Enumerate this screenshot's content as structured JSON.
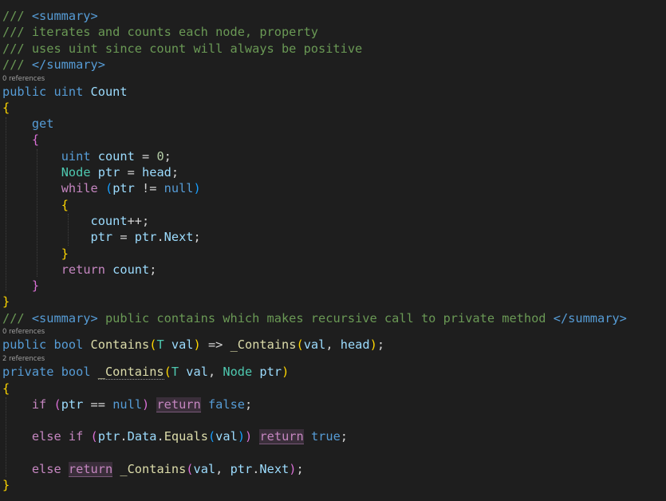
{
  "editor": {
    "code_lens": {
      "count": "0 references",
      "contains": "0 references",
      "private_contains": "2 references"
    },
    "lines": [
      {
        "id": "l1",
        "tokens": [
          {
            "t": "/// ",
            "c": "t-comment"
          },
          {
            "t": "<summary>",
            "c": "t-doctag"
          }
        ]
      },
      {
        "id": "l2",
        "tokens": [
          {
            "t": "/// iterates and counts each node, property",
            "c": "t-comment"
          }
        ]
      },
      {
        "id": "l3",
        "tokens": [
          {
            "t": "/// uses uint since count will always be positive",
            "c": "t-comment"
          }
        ]
      },
      {
        "id": "l4",
        "tokens": [
          {
            "t": "/// ",
            "c": "t-comment"
          },
          {
            "t": "</summary>",
            "c": "t-doctag"
          }
        ]
      },
      {
        "id": "l5",
        "tokens": [
          {
            "t": "public",
            "c": "t-kw"
          },
          {
            "t": " ",
            "c": "t-punc"
          },
          {
            "t": "uint",
            "c": "t-kw"
          },
          {
            "t": " ",
            "c": "t-punc"
          },
          {
            "t": "Count",
            "c": "t-var"
          }
        ]
      },
      {
        "id": "l6",
        "tokens": [
          {
            "t": "{",
            "c": "t-b1"
          }
        ]
      },
      {
        "id": "l7",
        "tokens": [
          {
            "t": "    ",
            "c": "t-punc"
          },
          {
            "t": "get",
            "c": "t-kw"
          }
        ]
      },
      {
        "id": "l8",
        "tokens": [
          {
            "t": "    ",
            "c": "t-punc"
          },
          {
            "t": "{",
            "c": "t-b2"
          }
        ]
      },
      {
        "id": "l9",
        "tokens": [
          {
            "t": "        ",
            "c": "t-punc"
          },
          {
            "t": "uint",
            "c": "t-kw"
          },
          {
            "t": " ",
            "c": "t-punc"
          },
          {
            "t": "count",
            "c": "t-var"
          },
          {
            "t": " = ",
            "c": "t-punc"
          },
          {
            "t": "0",
            "c": "t-num"
          },
          {
            "t": ";",
            "c": "t-punc"
          }
        ]
      },
      {
        "id": "l10",
        "tokens": [
          {
            "t": "        ",
            "c": "t-punc"
          },
          {
            "t": "Node",
            "c": "t-type"
          },
          {
            "t": " ",
            "c": "t-punc"
          },
          {
            "t": "ptr",
            "c": "t-var"
          },
          {
            "t": " = ",
            "c": "t-punc"
          },
          {
            "t": "head",
            "c": "t-var"
          },
          {
            "t": ";",
            "c": "t-punc"
          }
        ]
      },
      {
        "id": "l11",
        "tokens": [
          {
            "t": "        ",
            "c": "t-punc"
          },
          {
            "t": "while",
            "c": "t-ctrl"
          },
          {
            "t": " ",
            "c": "t-punc"
          },
          {
            "t": "(",
            "c": "t-b3"
          },
          {
            "t": "ptr",
            "c": "t-var"
          },
          {
            "t": " != ",
            "c": "t-punc"
          },
          {
            "t": "null",
            "c": "t-kw"
          },
          {
            "t": ")",
            "c": "t-b3"
          }
        ]
      },
      {
        "id": "l12",
        "tokens": [
          {
            "t": "        ",
            "c": "t-punc"
          },
          {
            "t": "{",
            "c": "t-b1"
          }
        ]
      },
      {
        "id": "l13",
        "tokens": [
          {
            "t": "            ",
            "c": "t-punc"
          },
          {
            "t": "count",
            "c": "t-var"
          },
          {
            "t": "++;",
            "c": "t-punc"
          }
        ]
      },
      {
        "id": "l14",
        "tokens": [
          {
            "t": "            ",
            "c": "t-punc"
          },
          {
            "t": "ptr",
            "c": "t-var"
          },
          {
            "t": " = ",
            "c": "t-punc"
          },
          {
            "t": "ptr",
            "c": "t-var"
          },
          {
            "t": ".",
            "c": "t-punc"
          },
          {
            "t": "Next",
            "c": "t-var"
          },
          {
            "t": ";",
            "c": "t-punc"
          }
        ]
      },
      {
        "id": "l15",
        "tokens": [
          {
            "t": "        ",
            "c": "t-punc"
          },
          {
            "t": "}",
            "c": "t-b1"
          }
        ]
      },
      {
        "id": "l16",
        "tokens": [
          {
            "t": "        ",
            "c": "t-punc"
          },
          {
            "t": "return",
            "c": "t-ctrl"
          },
          {
            "t": " ",
            "c": "t-punc"
          },
          {
            "t": "count",
            "c": "t-var"
          },
          {
            "t": ";",
            "c": "t-punc"
          }
        ]
      },
      {
        "id": "l17",
        "tokens": [
          {
            "t": "    ",
            "c": "t-punc"
          },
          {
            "t": "}",
            "c": "t-b2"
          }
        ]
      },
      {
        "id": "l18",
        "tokens": [
          {
            "t": "}",
            "c": "t-b1"
          }
        ]
      },
      {
        "id": "l19",
        "tokens": [
          {
            "t": "/// ",
            "c": "t-comment"
          },
          {
            "t": "<summary>",
            "c": "t-doctag"
          },
          {
            "t": " public contains which makes recursive call to private method ",
            "c": "t-comment"
          },
          {
            "t": "</summary>",
            "c": "t-doctag"
          }
        ]
      },
      {
        "id": "l20",
        "tokens": [
          {
            "t": "public",
            "c": "t-kw"
          },
          {
            "t": " ",
            "c": "t-punc"
          },
          {
            "t": "bool",
            "c": "t-kw"
          },
          {
            "t": " ",
            "c": "t-punc"
          },
          {
            "t": "Contains",
            "c": "t-fn"
          },
          {
            "t": "(",
            "c": "t-b1"
          },
          {
            "t": "T",
            "c": "t-type"
          },
          {
            "t": " ",
            "c": "t-punc"
          },
          {
            "t": "val",
            "c": "t-var"
          },
          {
            "t": ")",
            "c": "t-b1"
          },
          {
            "t": " => ",
            "c": "t-punc"
          },
          {
            "t": "_Contains",
            "c": "t-fn"
          },
          {
            "t": "(",
            "c": "t-b1"
          },
          {
            "t": "val",
            "c": "t-var"
          },
          {
            "t": ", ",
            "c": "t-punc"
          },
          {
            "t": "head",
            "c": "t-var"
          },
          {
            "t": ")",
            "c": "t-b1"
          },
          {
            "t": ";",
            "c": "t-punc"
          }
        ]
      },
      {
        "id": "l21",
        "tokens": [
          {
            "t": "private",
            "c": "t-kw"
          },
          {
            "t": " ",
            "c": "t-punc"
          },
          {
            "t": "bool",
            "c": "t-kw"
          },
          {
            "t": " ",
            "c": "t-punc"
          },
          {
            "t": "_Contains",
            "c": "t-fn squiggle"
          },
          {
            "t": "(",
            "c": "t-b1"
          },
          {
            "t": "T",
            "c": "t-type"
          },
          {
            "t": " ",
            "c": "t-punc"
          },
          {
            "t": "val",
            "c": "t-var"
          },
          {
            "t": ", ",
            "c": "t-punc"
          },
          {
            "t": "Node",
            "c": "t-type"
          },
          {
            "t": " ",
            "c": "t-punc"
          },
          {
            "t": "ptr",
            "c": "t-var"
          },
          {
            "t": ")",
            "c": "t-b1"
          }
        ]
      },
      {
        "id": "l22",
        "tokens": [
          {
            "t": "{",
            "c": "t-b1"
          }
        ]
      },
      {
        "id": "l23",
        "tokens": [
          {
            "t": "    ",
            "c": "t-punc"
          },
          {
            "t": "if",
            "c": "t-ctrl"
          },
          {
            "t": " ",
            "c": "t-punc"
          },
          {
            "t": "(",
            "c": "t-b2"
          },
          {
            "t": "ptr",
            "c": "t-var"
          },
          {
            "t": " == ",
            "c": "t-punc"
          },
          {
            "t": "null",
            "c": "t-kw"
          },
          {
            "t": ")",
            "c": "t-b2"
          },
          {
            "t": " ",
            "c": "t-punc"
          },
          {
            "t": "return",
            "c": "t-ctrl t-ret-hl"
          },
          {
            "t": " ",
            "c": "t-punc"
          },
          {
            "t": "false",
            "c": "t-kw"
          },
          {
            "t": ";",
            "c": "t-punc"
          }
        ]
      },
      {
        "id": "l24",
        "tokens": []
      },
      {
        "id": "l25",
        "tokens": [
          {
            "t": "    ",
            "c": "t-punc"
          },
          {
            "t": "else",
            "c": "t-ctrl"
          },
          {
            "t": " ",
            "c": "t-punc"
          },
          {
            "t": "if",
            "c": "t-ctrl"
          },
          {
            "t": " ",
            "c": "t-punc"
          },
          {
            "t": "(",
            "c": "t-b2"
          },
          {
            "t": "ptr",
            "c": "t-var"
          },
          {
            "t": ".",
            "c": "t-punc"
          },
          {
            "t": "Data",
            "c": "t-var"
          },
          {
            "t": ".",
            "c": "t-punc"
          },
          {
            "t": "Equals",
            "c": "t-fn"
          },
          {
            "t": "(",
            "c": "t-b3"
          },
          {
            "t": "val",
            "c": "t-var"
          },
          {
            "t": ")",
            "c": "t-b3"
          },
          {
            "t": ")",
            "c": "t-b2"
          },
          {
            "t": " ",
            "c": "t-punc"
          },
          {
            "t": "return",
            "c": "t-ctrl t-ret-hl"
          },
          {
            "t": " ",
            "c": "t-punc"
          },
          {
            "t": "true",
            "c": "t-kw"
          },
          {
            "t": ";",
            "c": "t-punc"
          }
        ]
      },
      {
        "id": "l26",
        "tokens": []
      },
      {
        "id": "l27",
        "tokens": [
          {
            "t": "    ",
            "c": "t-punc"
          },
          {
            "t": "else",
            "c": "t-ctrl"
          },
          {
            "t": " ",
            "c": "t-punc"
          },
          {
            "t": "return",
            "c": "t-ctrl t-ret-hl"
          },
          {
            "t": " ",
            "c": "t-punc"
          },
          {
            "t": "_Contains",
            "c": "t-fn"
          },
          {
            "t": "(",
            "c": "t-b2"
          },
          {
            "t": "val",
            "c": "t-var"
          },
          {
            "t": ", ",
            "c": "t-punc"
          },
          {
            "t": "ptr",
            "c": "t-var"
          },
          {
            "t": ".",
            "c": "t-punc"
          },
          {
            "t": "Next",
            "c": "t-var"
          },
          {
            "t": ")",
            "c": "t-b2"
          },
          {
            "t": ";",
            "c": "t-punc"
          }
        ]
      },
      {
        "id": "l28",
        "tokens": [
          {
            "t": "}",
            "c": "t-b1"
          }
        ]
      }
    ]
  },
  "colors": {
    "background": "#1e1e1e",
    "comment": "#6a9955",
    "keyword": "#569cd6",
    "control": "#c586c0",
    "type": "#4ec9b0",
    "variable": "#9cdcfe",
    "function": "#dcdcaa",
    "number": "#b5cea8"
  }
}
